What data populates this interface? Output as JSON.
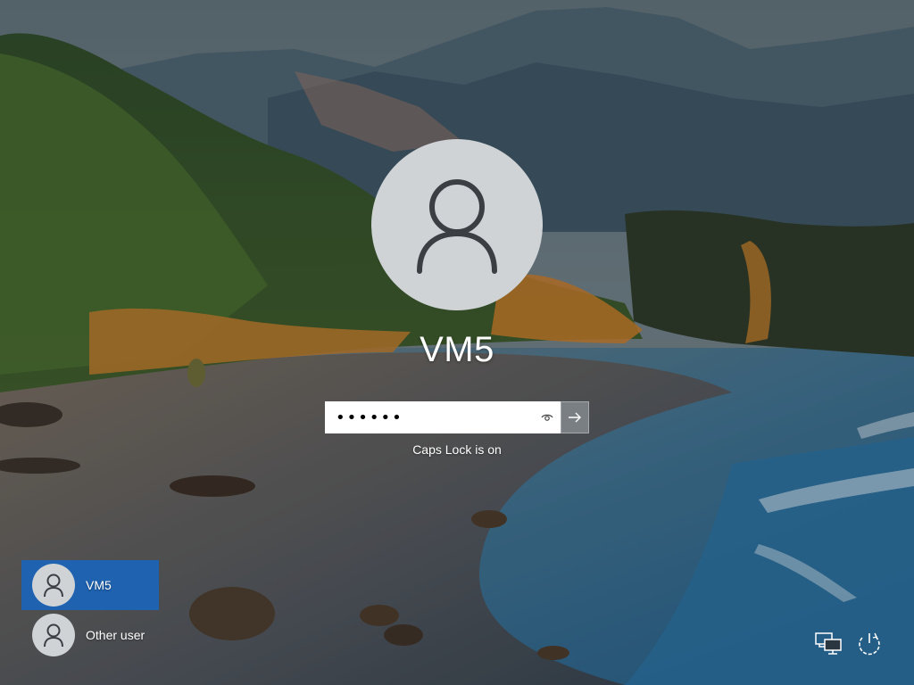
{
  "login": {
    "username": "VM5",
    "password_masked": "••••••",
    "caps_lock_message": "Caps Lock is on"
  },
  "user_list": [
    {
      "label": "VM5",
      "selected": true
    },
    {
      "label": "Other user",
      "selected": false
    }
  ],
  "icons": {
    "avatar": "user-silhouette-icon",
    "reveal": "eye-icon",
    "submit": "arrow-right-icon",
    "network": "network-icon",
    "power": "power-icon"
  },
  "colors": {
    "selected_user": "#1f62b0",
    "avatar_bg": "#cfd3d6",
    "submit_bg": "#7a7f84"
  }
}
